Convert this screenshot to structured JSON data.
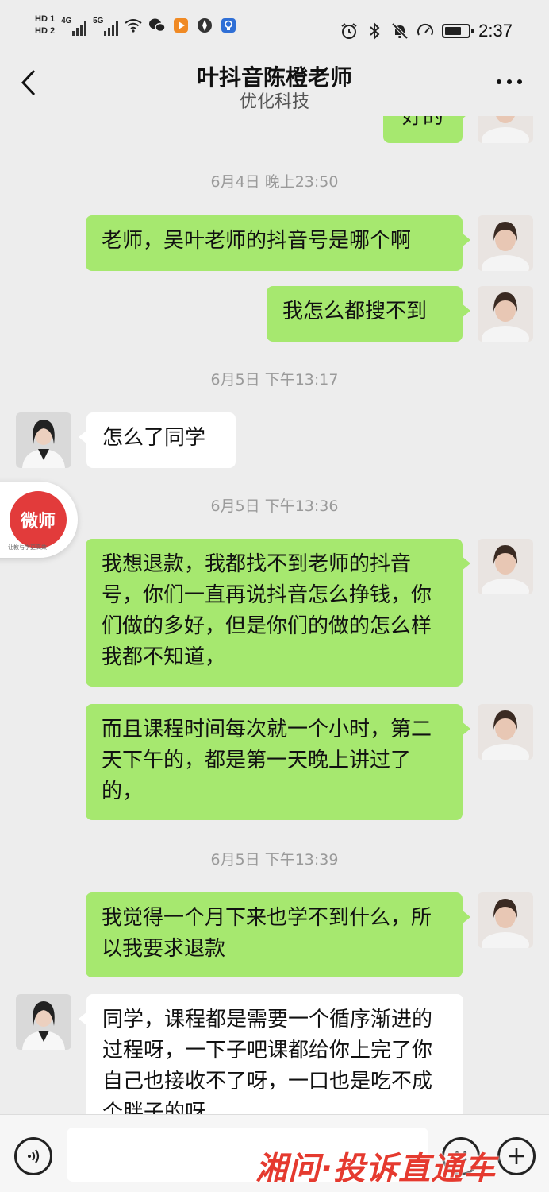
{
  "status_bar": {
    "hd1": "HD 1",
    "hd2": "HD 2",
    "net1": "4G",
    "net2": "5G",
    "time": "2:37"
  },
  "header": {
    "title": "叶抖音陈橙老师",
    "subtitle": "优化科技"
  },
  "messages": [
    {
      "type": "sent",
      "text": "好的"
    },
    {
      "type": "time",
      "text": "6月4日 晚上23:50"
    },
    {
      "type": "sent",
      "text": "老师，吴叶老师的抖音号是哪个啊"
    },
    {
      "type": "sent",
      "text": "我怎么都搜不到"
    },
    {
      "type": "time",
      "text": "6月5日 下午13:17"
    },
    {
      "type": "recv",
      "text": "怎么了同学"
    },
    {
      "type": "time",
      "text": "6月5日 下午13:36"
    },
    {
      "type": "sent",
      "text": "我想退款，我都找不到老师的抖音号，你们一直再说抖音怎么挣钱，你们做的多好，但是你们的做的怎么样我都不知道，"
    },
    {
      "type": "sent",
      "text": "而且课程时间每次就一个小时，第二天下午的，都是第一天晚上讲过了的，"
    },
    {
      "type": "time",
      "text": "6月5日 下午13:39"
    },
    {
      "type": "sent",
      "text": "我觉得一个月下来也学不到什么，所以我要求退款"
    },
    {
      "type": "recv",
      "text": "同学，课程都是需要一个循序渐进的过程呀，一下子吧课都给你上完了你自己也接收不了呀，一口也是吃不成个胖子的呀"
    }
  ],
  "weishi_badge": {
    "label": "微师",
    "tagline": "让教与学更高效"
  },
  "watermark": "湘问·投诉直通车",
  "colors": {
    "background": "#ededed",
    "sent_bubble": "#a6e86f",
    "recv_bubble": "#ffffff",
    "watermark": "#e53a2f",
    "weishi": "#e23b3b"
  }
}
